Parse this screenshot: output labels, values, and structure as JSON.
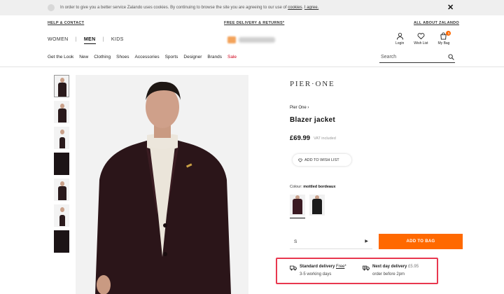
{
  "cookie_bar": {
    "text": "In order to give you a better service Zalando uses cookies. By continuing to browse the site you are agreeing to our use of ",
    "link_cookies": "cookies",
    "link_agree": "I agree."
  },
  "utility": {
    "help": "HELP & CONTACT",
    "delivery": "FREE DELIVERY & RETURNS*",
    "about": "ALL ABOUT ZALANDO"
  },
  "gender_nav": [
    "WOMEN",
    "MEN",
    "KIDS"
  ],
  "account": {
    "login": "Login",
    "wishlist": "Wish List",
    "bag": "My Bag",
    "bag_count": "1"
  },
  "categories": [
    "Get the Look",
    "New",
    "Clothing",
    "Shoes",
    "Accessories",
    "Sports",
    "Designer",
    "Brands",
    "Sale"
  ],
  "search": {
    "placeholder": "Search"
  },
  "product": {
    "brand_logo": "PIER·ONE",
    "brand_link": "Pier One",
    "name": "Blazer jacket",
    "price": "£69.99",
    "vat": "VAT included",
    "wishlist_label": "ADD TO WISH LIST",
    "colour_label": "Colour:",
    "colour_value": "mottled bordeaux",
    "size_value": "S",
    "add_to_bag": "ADD TO BAG"
  },
  "delivery": {
    "standard_title": "Standard delivery",
    "standard_free": "Free",
    "standard_days": "3-5 working days",
    "next_title": "Next day delivery",
    "next_fee": "£5.95",
    "next_note": "order before 2pm"
  },
  "colors": {
    "accent": "#ff6900",
    "sale": "#d0021b",
    "highlight_border": "#e8384f"
  }
}
